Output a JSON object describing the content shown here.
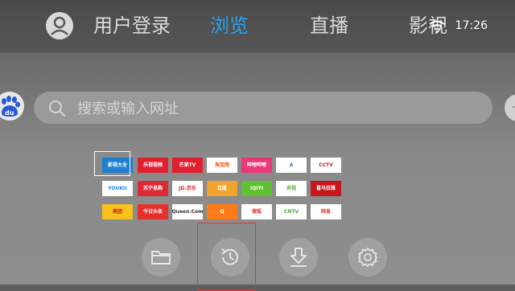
{
  "header": {
    "tabs": [
      {
        "label": "用户登录"
      },
      {
        "label": "浏览"
      },
      {
        "label": "直播"
      },
      {
        "label": "影视"
      }
    ],
    "time": "17:26"
  },
  "search": {
    "placeholder": "搜索或输入网址",
    "engine_icon": "baidu-du-icon"
  },
  "shortcuts": [
    {
      "label": "影视大全",
      "bg": "#1e7fd1",
      "fg": "#ffffff"
    },
    {
      "label": "乐视视频",
      "bg": "#e0202f",
      "fg": "#ffffff"
    },
    {
      "label": "芒果TV",
      "bg": "#e0202f",
      "fg": "#ffffff"
    },
    {
      "label": "淘宝网",
      "bg": "#ffffff",
      "fg": "#ff5000"
    },
    {
      "label": "哔哩哔哩",
      "bg": "#e8377b",
      "fg": "#ffffff"
    },
    {
      "label": "A",
      "bg": "#ffffff",
      "fg": "#3c6fd6"
    },
    {
      "label": "CCTV",
      "bg": "#ffffff",
      "fg": "#c8161d"
    },
    {
      "label": "YOUKU",
      "bg": "#ffffff",
      "fg": "#1e88e5"
    },
    {
      "label": "苏宁易购",
      "bg": "#e02737",
      "fg": "#ffffff"
    },
    {
      "label": "JD.京东",
      "bg": "#ffffff",
      "fg": "#e1251b"
    },
    {
      "label": "百度",
      "bg": "#f2a32e",
      "fg": "#ffffff"
    },
    {
      "label": "iQIYI",
      "bg": "#61c132",
      "fg": "#ffffff"
    },
    {
      "label": "央视",
      "bg": "#ffffff",
      "fg": "#5aa832"
    },
    {
      "label": "喜马拉雅",
      "bg": "#c8161d",
      "fg": "#ffffff"
    },
    {
      "label": "美团",
      "bg": "#f7c21b",
      "fg": "#c8161d"
    },
    {
      "label": "今日头条",
      "bg": "#e8302b",
      "fg": "#ffffff"
    },
    {
      "label": "Queen.Com",
      "bg": "#ffffff",
      "fg": "#333333"
    },
    {
      "label": "Q",
      "bg": "#ff7a1a",
      "fg": "#ffffff"
    },
    {
      "label": "搜狐",
      "bg": "#ffffff",
      "fg": "#e8302b"
    },
    {
      "label": "CNTV",
      "bg": "#ffffff",
      "fg": "#53a343"
    },
    {
      "label": "网易",
      "bg": "#ffffff",
      "fg": "#e8302b"
    }
  ],
  "bottom_toolbar": [
    {
      "icon": "folder-icon"
    },
    {
      "icon": "history-icon"
    },
    {
      "icon": "download-icon"
    },
    {
      "icon": "settings-icon"
    }
  ],
  "accent": "#27a3f0",
  "highlight_color": "#e8342d"
}
